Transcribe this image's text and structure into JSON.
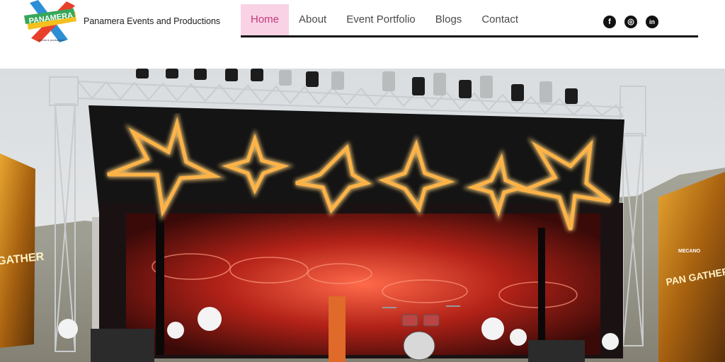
{
  "brand": {
    "logo_text": "PANAMERA",
    "logo_subtext": "events & productions",
    "name": "Panamera Events and Productions"
  },
  "nav": {
    "items": [
      {
        "label": "Home",
        "active": true
      },
      {
        "label": "About",
        "active": false
      },
      {
        "label": "Event Portfolio",
        "active": false
      },
      {
        "label": "Blogs",
        "active": false
      },
      {
        "label": "Contact",
        "active": false
      }
    ]
  },
  "social": {
    "facebook": "f",
    "instagram": "◎",
    "linkedin": "in"
  },
  "hero": {
    "banner_text_left": "GATHER",
    "banner_text_right": "PAN GATHER",
    "banner_logo": "MECANO"
  },
  "colors": {
    "active_bg": "#f9d2e6",
    "active_text": "#c4387b",
    "nav_line": "#111111",
    "star_glow": "#ffb347"
  }
}
